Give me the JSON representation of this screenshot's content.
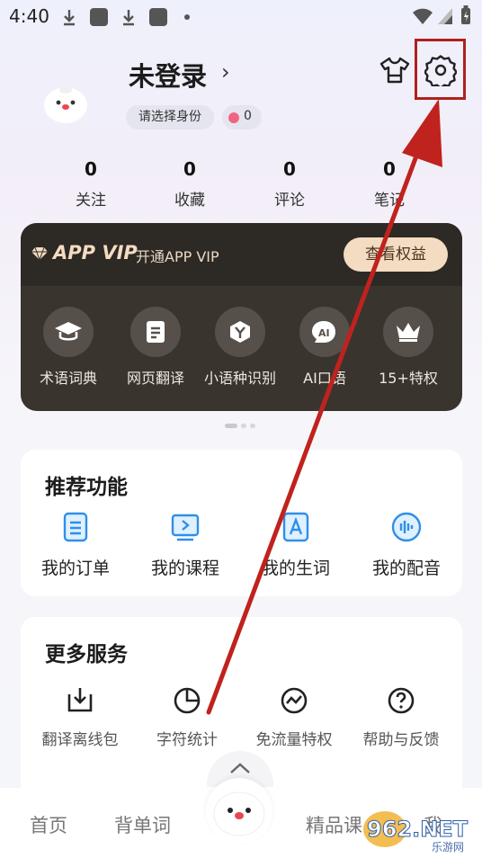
{
  "status_bar": {
    "time": "4:40"
  },
  "profile": {
    "username": "未登录",
    "identity_label": "请选择身份",
    "coins": "0"
  },
  "stats": [
    {
      "value": "0",
      "label": "关注"
    },
    {
      "value": "0",
      "label": "收藏"
    },
    {
      "value": "0",
      "label": "评论"
    },
    {
      "value": "0",
      "label": "笔记"
    }
  ],
  "vip": {
    "brand": "APP VIP",
    "open_label": "开通APP VIP",
    "view_button": "查看权益",
    "features": [
      {
        "label": "术语词典",
        "icon": "graduation-cap-icon"
      },
      {
        "label": "网页翻译",
        "icon": "document-icon"
      },
      {
        "label": "小语种识别",
        "icon": "hexagon-y-icon"
      },
      {
        "label": "AI口语",
        "icon": "ai-speech-icon"
      },
      {
        "label": "15+特权",
        "icon": "crown-icon"
      }
    ]
  },
  "recommend": {
    "title": "推荐功能",
    "items": [
      {
        "label": "我的订单",
        "icon": "order-list-icon"
      },
      {
        "label": "我的课程",
        "icon": "course-play-icon"
      },
      {
        "label": "我的生词",
        "icon": "vocabulary-a-icon"
      },
      {
        "label": "我的配音",
        "icon": "audio-wave-icon"
      }
    ]
  },
  "services": {
    "title": "更多服务",
    "items": [
      {
        "label": "翻译离线包",
        "icon": "download-icon"
      },
      {
        "label": "字符统计",
        "icon": "pie-chart-icon"
      },
      {
        "label": "免流量特权",
        "icon": "trend-wave-icon"
      },
      {
        "label": "帮助与反馈",
        "icon": "help-icon"
      }
    ]
  },
  "bottom_nav": {
    "home": "首页",
    "words": "背单词",
    "premium": "精品课",
    "mine": "我"
  },
  "watermark": {
    "text": "962.NET",
    "sub": "乐游网"
  },
  "colors": {
    "highlight": "#b0201c",
    "vip_bg": "#3a342f",
    "vip_button": "#f4dcc2",
    "accent_blue": "#2f8fe8"
  }
}
